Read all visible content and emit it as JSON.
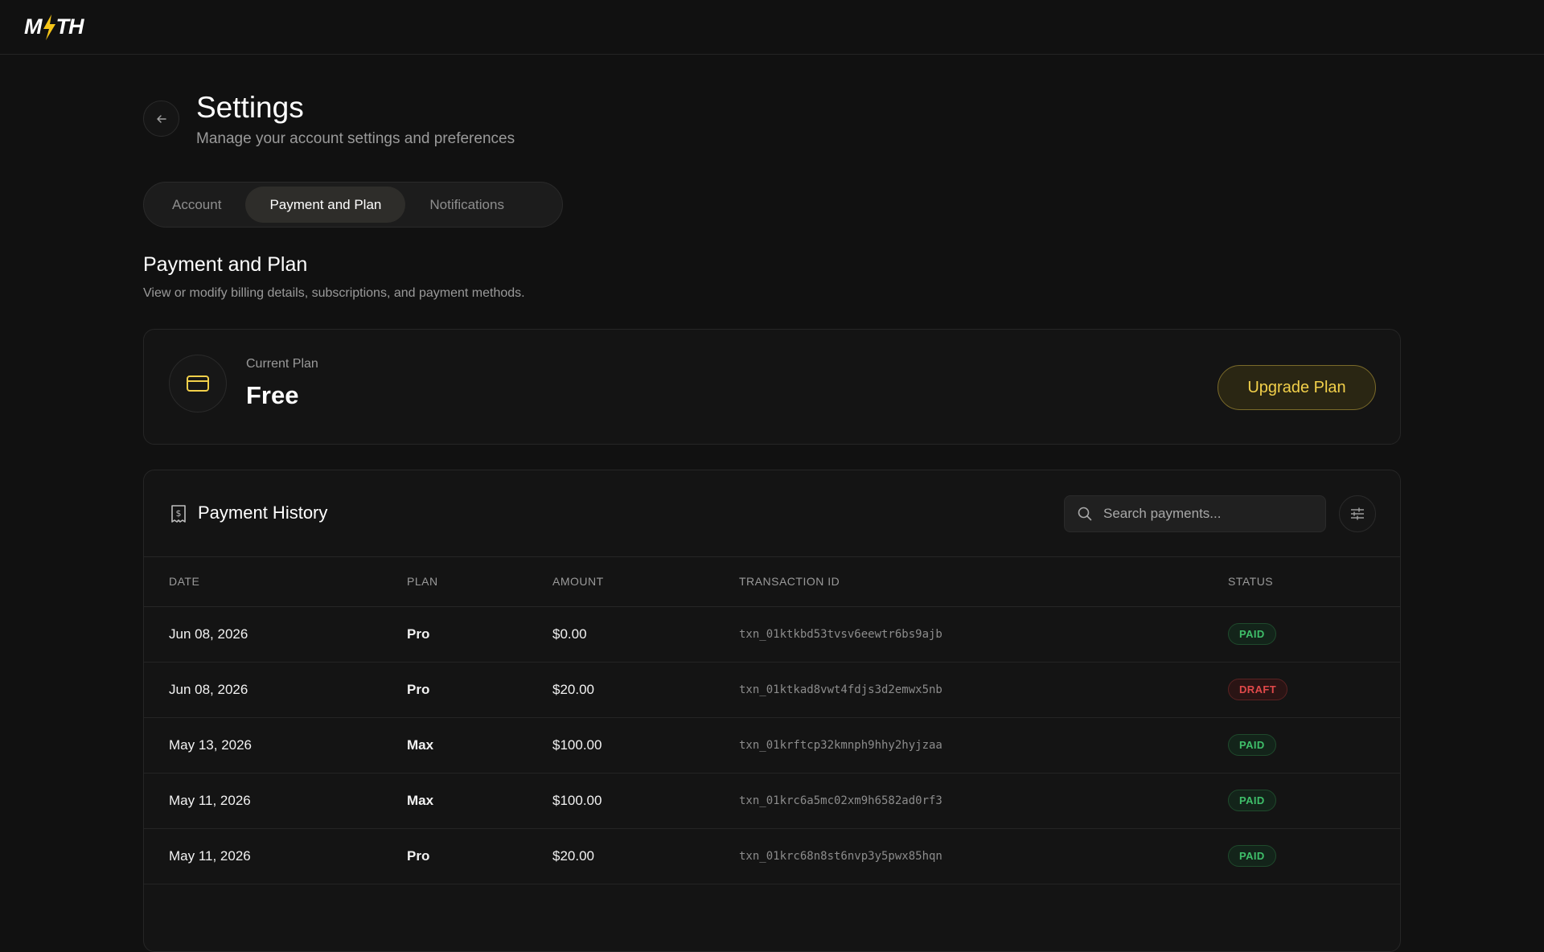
{
  "app": {
    "logo_text_left": "M",
    "logo_text_right": "TH",
    "logo_accent": "#f5c518"
  },
  "header": {
    "title": "Settings",
    "subtitle": "Manage your account settings and preferences"
  },
  "tabs": [
    {
      "label": "Account",
      "active": false
    },
    {
      "label": "Payment and Plan",
      "active": true
    },
    {
      "label": "Notifications",
      "active": false
    }
  ],
  "section": {
    "title": "Payment and Plan",
    "subtitle": "View or modify billing details, subscriptions, and payment methods."
  },
  "plan": {
    "label": "Current Plan",
    "name": "Free",
    "upgrade_label": "Upgrade Plan",
    "icon": "credit-card-icon"
  },
  "history": {
    "title": "Payment History",
    "icon": "receipt-dollar-icon",
    "search_placeholder": "Search payments...",
    "columns": [
      "DATE",
      "PLAN",
      "AMOUNT",
      "TRANSACTION ID",
      "STATUS"
    ],
    "rows": [
      {
        "date": "Jun 08, 2026",
        "plan": "Pro",
        "amount": "$0.00",
        "txn": "txn_01ktkbd53tvsv6eewtr6bs9ajb",
        "status": "PAID"
      },
      {
        "date": "Jun 08, 2026",
        "plan": "Pro",
        "amount": "$20.00",
        "txn": "txn_01ktkad8vwt4fdjs3d2emwx5nb",
        "status": "DRAFT"
      },
      {
        "date": "May 13, 2026",
        "plan": "Max",
        "amount": "$100.00",
        "txn": "txn_01krftcp32kmnph9hhy2hyjzaa",
        "status": "PAID"
      },
      {
        "date": "May 11, 2026",
        "plan": "Max",
        "amount": "$100.00",
        "txn": "txn_01krc6a5mc02xm9h6582ad0rf3",
        "status": "PAID"
      },
      {
        "date": "May 11, 2026",
        "plan": "Pro",
        "amount": "$20.00",
        "txn": "txn_01krc68n8st6nvp3y5pwx85hqn",
        "status": "PAID"
      }
    ]
  },
  "colors": {
    "paid": "#3fbf6a",
    "draft": "#e0494a",
    "accent": "#f2d04a"
  }
}
